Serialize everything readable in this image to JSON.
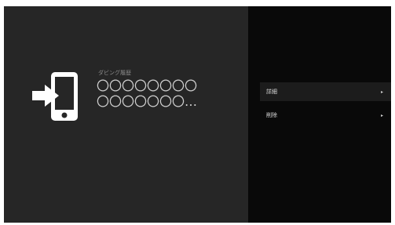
{
  "history": {
    "label": "ダビング履歴",
    "value_line1": "〇〇〇〇〇〇〇〇",
    "value_line2": "〇〇〇〇〇〇〇…"
  },
  "menu": {
    "items": [
      {
        "label": "詳細",
        "chevron": "▸",
        "selected": true
      },
      {
        "label": "削除",
        "chevron": "▸",
        "selected": false
      }
    ]
  },
  "icons": {
    "main": "phone-import-icon",
    "chevron": "chevron-right-icon"
  },
  "colors": {
    "left_panel": "#262626",
    "right_panel": "#090909",
    "icon": "#ffffff",
    "selected_row": "#1c1c1c"
  }
}
